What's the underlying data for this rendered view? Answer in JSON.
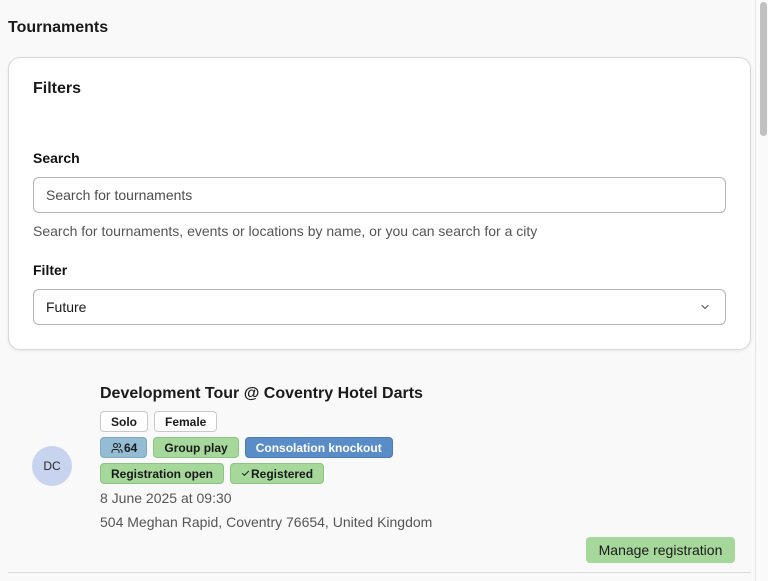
{
  "page": {
    "title": "Tournaments"
  },
  "filters": {
    "heading": "Filters",
    "search_label": "Search",
    "search_placeholder": "Search for tournaments",
    "search_help": "Search for tournaments, events or locations by name, or you can search for a city",
    "filter_label": "Filter",
    "filter_value": "Future"
  },
  "tournaments": [
    {
      "avatar_initials": "DC",
      "name": "Development Tour @ Coventry Hotel Darts",
      "tags": [
        "Solo",
        "Female"
      ],
      "participants": "64",
      "format": [
        "Group play",
        "Consolation knockout"
      ],
      "status": [
        "Registration open",
        "Registered"
      ],
      "date": "8 June 2025 at 09:30",
      "location": "504 Meghan Rapid, Coventry 76654, United Kingdom",
      "action_label": "Manage registration"
    }
  ],
  "icons": {
    "participants": "users-icon",
    "registered": "check-icon",
    "filter_select": "chevron-down-icon"
  },
  "colors": {
    "page_background": "#f9f9f9",
    "card_background": "#ffffff",
    "tag_green": "#a6d79b",
    "tag_steel": "#94bcd2",
    "tag_blue": "#5a8cc7",
    "avatar": "#c8d4ef"
  }
}
